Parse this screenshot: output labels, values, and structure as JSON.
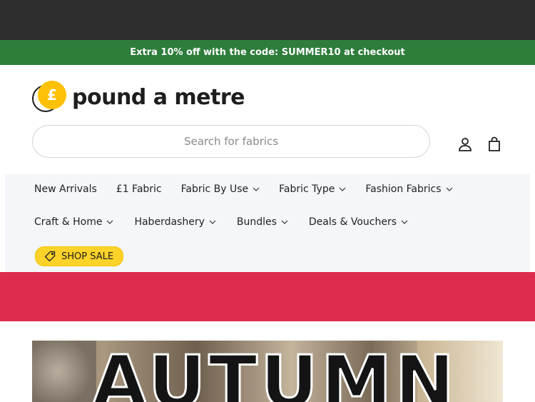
{
  "promo": {
    "text": "Extra 10% off with the code: SUMMER10 at checkout"
  },
  "logo": {
    "symbol": "£",
    "text": "pound a metre"
  },
  "search": {
    "placeholder": "Search for fabrics"
  },
  "header_icons": {
    "account": "user-icon",
    "cart": "shopping-bag-icon"
  },
  "nav": {
    "row1": [
      {
        "label": "New Arrivals",
        "dropdown": false
      },
      {
        "label": "£1 Fabric",
        "dropdown": false
      },
      {
        "label": "Fabric By Use",
        "dropdown": true
      },
      {
        "label": "Fabric Type",
        "dropdown": true
      },
      {
        "label": "Fashion Fabrics",
        "dropdown": true
      }
    ],
    "row2": [
      {
        "label": "Craft & Home",
        "dropdown": true
      },
      {
        "label": "Haberdashery",
        "dropdown": true
      },
      {
        "label": "Bundles",
        "dropdown": true
      },
      {
        "label": "Deals & Vouchers",
        "dropdown": true
      }
    ],
    "sale_button": "SHOP SALE"
  },
  "hero": {
    "title": "AUTUMN"
  },
  "colors": {
    "promo_bg": "#2e7d3b",
    "accent_yellow": "#ffc107",
    "red_band": "#dd2b4c",
    "top_bar": "#2e2e2e"
  }
}
